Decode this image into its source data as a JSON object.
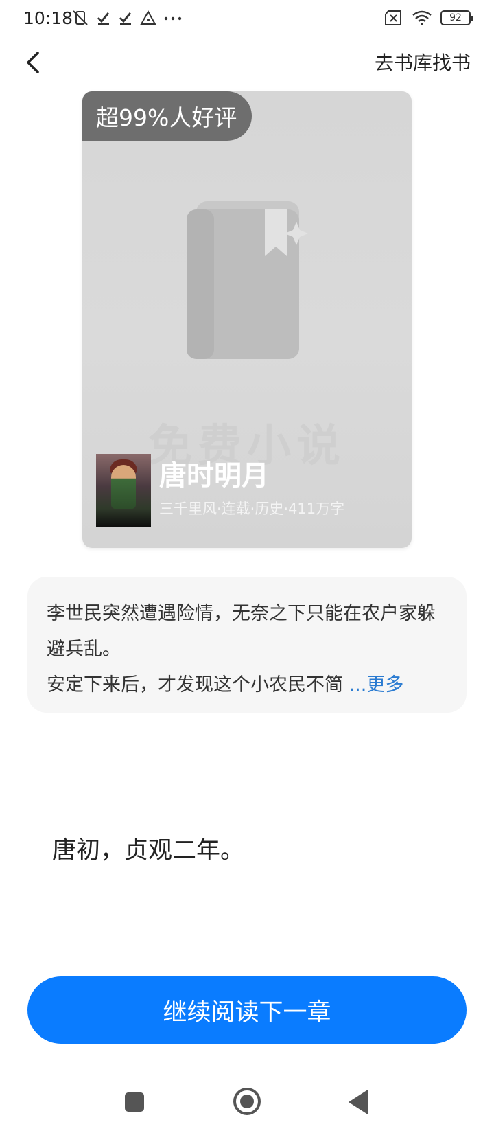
{
  "status_bar": {
    "time": "10:18",
    "battery": "92",
    "left_icons": [
      "mute-vibrate-icon",
      "check-icon",
      "check-icon",
      "warning-triangle-icon",
      "more-dots-icon"
    ],
    "right_icons": [
      "sim-x-icon",
      "wifi-icon",
      "battery-icon"
    ]
  },
  "nav": {
    "find_book_label": "去书库找书"
  },
  "cover": {
    "rating_badge": "超99%人好评",
    "placeholder_text": "免费小说",
    "title": "唐时明月",
    "subtitle": "三千里风·连载·历史·411万字"
  },
  "summary": {
    "text": "李世民突然遭遇险情，无奈之下只能在农户家躲避兵乱。",
    "text_line2": "安定下来后，才发现这个小农民不简",
    "more_label": "...更多"
  },
  "chapter": {
    "first_line": "唐初，贞观二年。"
  },
  "actions": {
    "continue_label": "继续阅读下一章"
  },
  "colors": {
    "accent": "#0a7cff",
    "link": "#2a7bd1",
    "summary_bg": "#f6f6f6"
  }
}
